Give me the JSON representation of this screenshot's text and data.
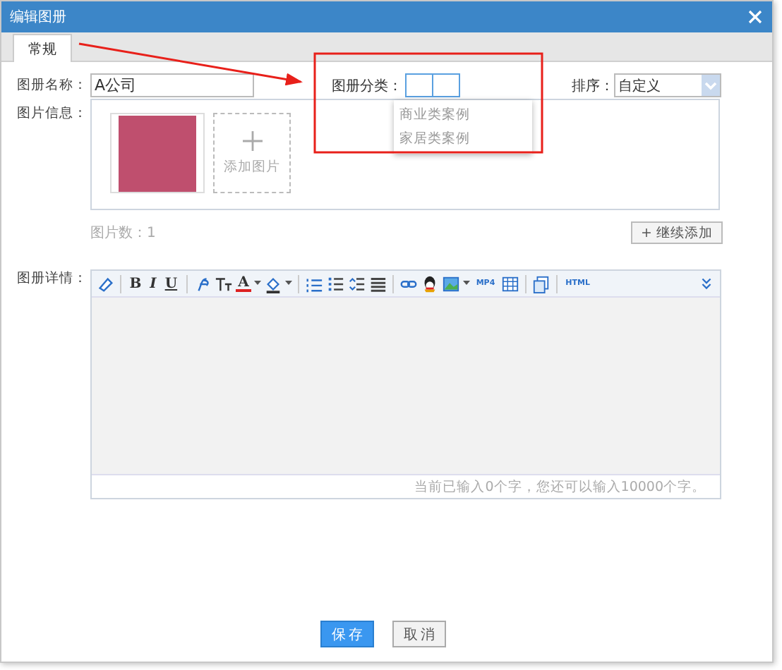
{
  "window": {
    "title": "编辑图册"
  },
  "tabs": [
    {
      "label": "常规",
      "selected": true
    }
  ],
  "form": {
    "name_label": "图册名称：",
    "name_value": "A公司",
    "category_label": "图册分类：",
    "category_options": [
      "商业类案例",
      "家居类案例"
    ],
    "sort_label": "排序：",
    "sort_value": "自定义",
    "images_label": "图片信息：",
    "add_image_label": "添加图片",
    "image_count": "图片数：1",
    "add_more_button": "+ 继续添加",
    "details_label": "图册详情：",
    "toolbar_texts": [
      "B",
      "I",
      "U",
      "A",
      "MP4",
      "HTML"
    ],
    "char_count": "当前已输入0个字，您还可以输入10000个字。"
  },
  "buttons": [
    {
      "label": "保存",
      "kind": "primary"
    },
    {
      "label": "取消",
      "kind": "secondary"
    }
  ]
}
